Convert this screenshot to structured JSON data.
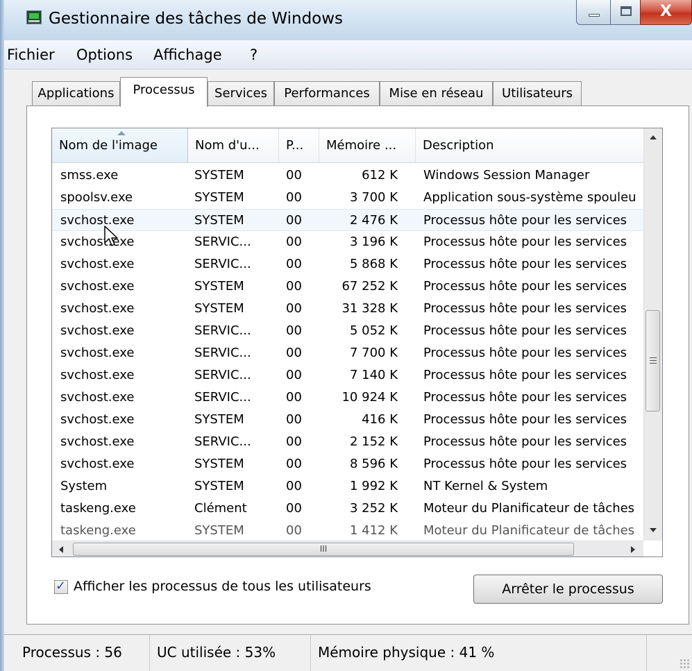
{
  "window": {
    "title": "Gestionnaire des tâches de Windows",
    "close_glyph": "X"
  },
  "menu": [
    "Fichier",
    "Options",
    "Affichage",
    "?"
  ],
  "tabs": [
    {
      "label": "Applications",
      "active": false
    },
    {
      "label": "Processus",
      "active": true
    },
    {
      "label": "Services",
      "active": false
    },
    {
      "label": "Performances",
      "active": false
    },
    {
      "label": "Mise en réseau",
      "active": false
    },
    {
      "label": "Utilisateurs",
      "active": false
    }
  ],
  "columns": [
    "Nom de l'image",
    "Nom d'u...",
    "P...",
    "Mémoire ...",
    "Description"
  ],
  "rows": [
    {
      "name": "smss.exe",
      "user": "SYSTEM",
      "cpu": "00",
      "memory": "612 K",
      "description": "Windows Session Manager"
    },
    {
      "name": "spoolsv.exe",
      "user": "SYSTEM",
      "cpu": "00",
      "memory": "3 700 K",
      "description": "Application sous-système spouleu"
    },
    {
      "name": "svchost.exe",
      "user": "SYSTEM",
      "cpu": "00",
      "memory": "2 476 K",
      "description": "Processus hôte pour les services"
    },
    {
      "name": "svchost.exe",
      "user": "SERVIC...",
      "cpu": "00",
      "memory": "3 196 K",
      "description": "Processus hôte pour les services"
    },
    {
      "name": "svchost.exe",
      "user": "SERVIC...",
      "cpu": "00",
      "memory": "5 868 K",
      "description": "Processus hôte pour les services"
    },
    {
      "name": "svchost.exe",
      "user": "SYSTEM",
      "cpu": "00",
      "memory": "67 252 K",
      "description": "Processus hôte pour les services"
    },
    {
      "name": "svchost.exe",
      "user": "SYSTEM",
      "cpu": "00",
      "memory": "31 328 K",
      "description": "Processus hôte pour les services"
    },
    {
      "name": "svchost.exe",
      "user": "SERVIC...",
      "cpu": "00",
      "memory": "5 052 K",
      "description": "Processus hôte pour les services"
    },
    {
      "name": "svchost.exe",
      "user": "SERVIC...",
      "cpu": "00",
      "memory": "7 700 K",
      "description": "Processus hôte pour les services"
    },
    {
      "name": "svchost.exe",
      "user": "SERVIC...",
      "cpu": "00",
      "memory": "7 140 K",
      "description": "Processus hôte pour les services"
    },
    {
      "name": "svchost.exe",
      "user": "SERVIC...",
      "cpu": "00",
      "memory": "10 924 K",
      "description": "Processus hôte pour les services"
    },
    {
      "name": "svchost.exe",
      "user": "SYSTEM",
      "cpu": "00",
      "memory": "416 K",
      "description": "Processus hôte pour les services"
    },
    {
      "name": "svchost.exe",
      "user": "SERVIC...",
      "cpu": "00",
      "memory": "2 152 K",
      "description": "Processus hôte pour les services"
    },
    {
      "name": "svchost.exe",
      "user": "SYSTEM",
      "cpu": "00",
      "memory": "8 596 K",
      "description": "Processus hôte pour les services"
    },
    {
      "name": "System",
      "user": "SYSTEM",
      "cpu": "00",
      "memory": "1 992 K",
      "description": "NT Kernel & System"
    },
    {
      "name": "taskeng.exe",
      "user": "Clément",
      "cpu": "00",
      "memory": "3 252 K",
      "description": "Moteur du Planificateur de tâches"
    },
    {
      "name": "taskeng.exe",
      "user": "SYSTEM",
      "cpu": "00",
      "memory": "1 412 K",
      "description": "Moteur du Planificateur de tâches"
    }
  ],
  "hscroll_label": "III",
  "show_all_users": {
    "label": "Afficher les processus de tous les utilisateurs",
    "checked": true
  },
  "end_process_button": "Arrêter le processus",
  "status": {
    "processes": "Processus : 56",
    "cpu": "UC utilisée : 53%",
    "memory": "Mémoire physique : 41 %"
  }
}
